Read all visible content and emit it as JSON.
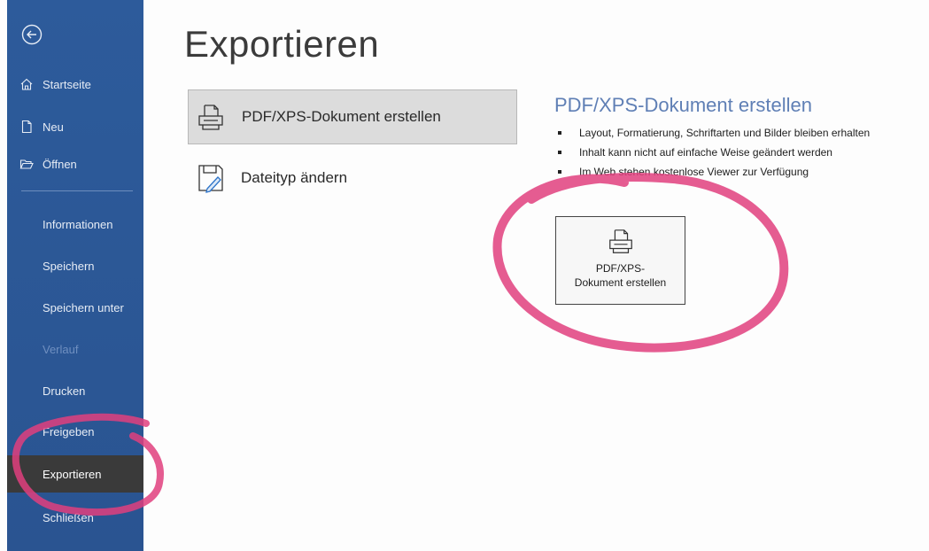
{
  "sidebar": {
    "top_items": [
      {
        "label": "Startseite",
        "icon": "home-icon"
      },
      {
        "label": "Neu",
        "icon": "new-document-icon"
      },
      {
        "label": "Öffnen",
        "icon": "folder-open-icon"
      }
    ],
    "items": [
      {
        "label": "Informationen"
      },
      {
        "label": "Speichern"
      },
      {
        "label": "Speichern unter"
      },
      {
        "label": "Verlauf"
      },
      {
        "label": "Drucken"
      },
      {
        "label": "Freigeben"
      },
      {
        "label": "Exportieren"
      },
      {
        "label": "Schließen"
      }
    ]
  },
  "main": {
    "title": "Exportieren",
    "options": [
      {
        "label": "PDF/XPS-Dokument erstellen",
        "icon": "pdf-document-icon",
        "selected": true
      },
      {
        "label": "Dateityp ändern",
        "icon": "change-file-type-icon",
        "selected": false
      }
    ]
  },
  "detail": {
    "title": "PDF/XPS-Dokument erstellen",
    "bullets": [
      "Layout, Formatierung, Schriftarten und Bilder bleiben erhalten",
      "Inhalt kann nicht auf einfache Weise geändert werden",
      "Im Web stehen kostenlose Viewer zur Verfügung"
    ],
    "button_line1": "PDF/XPS-",
    "button_line2": "Dokument erstellen"
  },
  "colors": {
    "sidebar": "#2b5797",
    "selected_nav": "#3a3a3a",
    "accent_title": "#5f7fb5",
    "annotation": "#e0407e"
  }
}
